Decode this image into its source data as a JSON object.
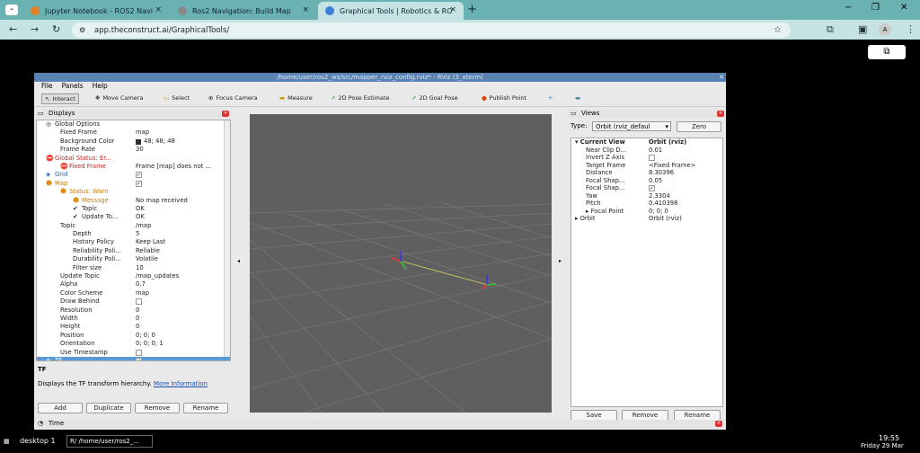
{
  "browser": {
    "tabs": [
      {
        "title": "Jupyter Notebook - ROS2 Navi"
      },
      {
        "title": "Ros2 Navigation: Build Map"
      },
      {
        "title": "Graphical Tools | Robotics & RO"
      }
    ],
    "url": "app.theconstruct.ai/GraphicalTools/",
    "avatar": "A"
  },
  "rviz": {
    "window_title": "/home/user/ros2_ws/src/mapper_rviz_config.rviz* - RViz (3_xterm)",
    "menu": [
      "File",
      "Panels",
      "Help"
    ],
    "tools": [
      "Interact",
      "Move Camera",
      "Select",
      "Focus Camera",
      "Measure",
      "2D Pose Estimate",
      "2D Goal Pose",
      "Publish Point"
    ],
    "displays_title": "Displays",
    "rows": [
      {
        "k": "Global Options",
        "v": ""
      },
      {
        "k": "Fixed Frame",
        "v": "map"
      },
      {
        "k": "Background Color",
        "v": "48; 48; 48"
      },
      {
        "k": "Frame Rate",
        "v": "30"
      },
      {
        "k": "Global Status: Er...",
        "v": ""
      },
      {
        "k": "Fixed Frame",
        "v": "Frame [map] does not ..."
      },
      {
        "k": "Grid",
        "v": ""
      },
      {
        "k": "Map",
        "v": ""
      },
      {
        "k": "Status: Warn",
        "v": ""
      },
      {
        "k": "Message",
        "v": "No map received"
      },
      {
        "k": "Topic",
        "v": "OK"
      },
      {
        "k": "Update To...",
        "v": "OK"
      },
      {
        "k": "Topic",
        "v": "/map"
      },
      {
        "k": "Depth",
        "v": "5"
      },
      {
        "k": "History Policy",
        "v": "Keep Last"
      },
      {
        "k": "Reliability Poli...",
        "v": "Reliable"
      },
      {
        "k": "Durability Poli...",
        "v": "Volatile"
      },
      {
        "k": "Filter size",
        "v": "10"
      },
      {
        "k": "Update Topic",
        "v": "/map_updates"
      },
      {
        "k": "Alpha",
        "v": "0.7"
      },
      {
        "k": "Color Scheme",
        "v": "map"
      },
      {
        "k": "Draw Behind",
        "v": ""
      },
      {
        "k": "Resolution",
        "v": "0"
      },
      {
        "k": "Width",
        "v": "0"
      },
      {
        "k": "Height",
        "v": "0"
      },
      {
        "k": "Position",
        "v": "0; 0; 0"
      },
      {
        "k": "Orientation",
        "v": "0; 0; 0; 1"
      },
      {
        "k": "Use Timestamp",
        "v": ""
      },
      {
        "k": "TF",
        "v": ""
      }
    ],
    "desc_title": "TF",
    "desc_text": "Displays the TF transform hierarchy.",
    "desc_link": "More Information",
    "buttons": [
      "Add",
      "Duplicate",
      "Remove",
      "Rename"
    ],
    "views_title": "Views",
    "type_label": "Type:",
    "type_value": "Orbit (rviz_defaul",
    "zero": "Zero",
    "vrows": [
      {
        "k": "Current View",
        "v": "Orbit (rviz)"
      },
      {
        "k": "Near Clip D...",
        "v": "0.01"
      },
      {
        "k": "Invert Z Axis",
        "v": ""
      },
      {
        "k": "Target Frame",
        "v": "<Fixed Frame>"
      },
      {
        "k": "Distance",
        "v": "8.30396"
      },
      {
        "k": "Focal Shap...",
        "v": "0.05"
      },
      {
        "k": "Focal Shap...",
        "v": ""
      },
      {
        "k": "Yaw",
        "v": "2.3304"
      },
      {
        "k": "Pitch",
        "v": "0.410398"
      },
      {
        "k": "Focal Point",
        "v": "0; 0; 0"
      },
      {
        "k": "Orbit",
        "v": "Orbit (rviz)"
      }
    ],
    "vbuttons": [
      "Save",
      "Remove",
      "Rename"
    ],
    "time_title": "Time"
  },
  "taskbar": {
    "desktop": "desktop 1",
    "task": "/home/user/ros2_...",
    "time": "19:55",
    "date": "Friday 29 Mar"
  }
}
